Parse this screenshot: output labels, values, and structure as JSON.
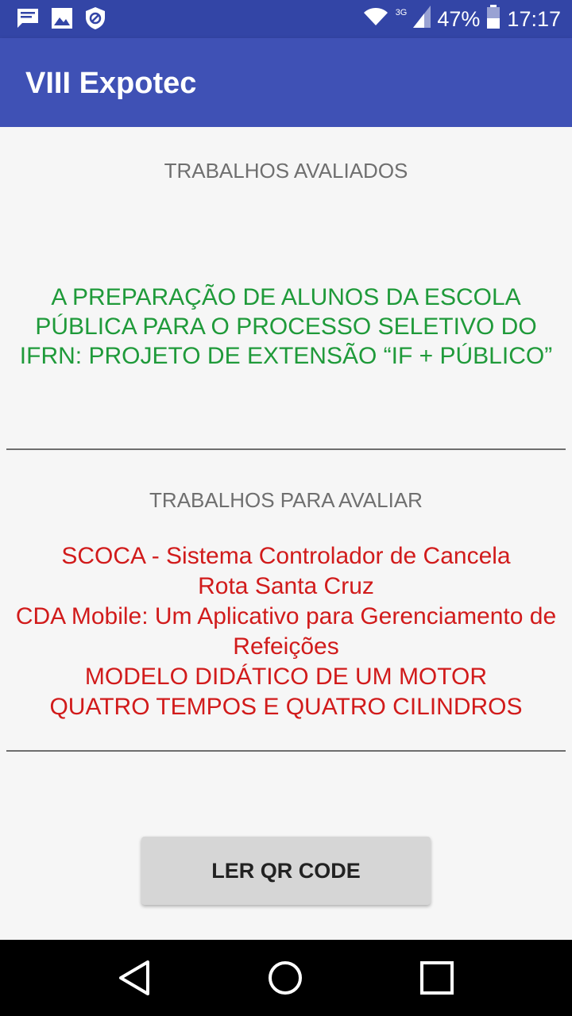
{
  "status_bar": {
    "network": "3G",
    "battery": "47%",
    "time": "17:17",
    "icons": [
      "message-icon",
      "image-icon",
      "shield-icon",
      "wifi-icon",
      "signal-icon",
      "battery-icon"
    ]
  },
  "app_bar": {
    "title": "VIII Expotec"
  },
  "evaluated_section": {
    "title": "TRABALHOS AVALIADOS",
    "items": [
      "A PREPARAÇÃO DE ALUNOS DA ESCOLA PÚBLICA PARA O PROCESSO SELETIVO DO IFRN: PROJETO DE EXTENSÃO “IF + PÚBLICO”"
    ],
    "color": "#1f9a3a"
  },
  "pending_section": {
    "title": "TRABALHOS PARA AVALIAR",
    "items": [
      "SCOCA - Sistema Controlador de Cancela",
      "Rota Santa Cruz",
      "CDA Mobile: Um Aplicativo para Gerenciamento de Refeições",
      "MODELO DIDÁTICO DE UM MOTOR QUATRO TEMPOS E QUATRO CILINDROS"
    ],
    "color": "#d11b1b"
  },
  "action_button": {
    "label": "LER QR CODE"
  },
  "nav_bar": {
    "icons": [
      "back-icon",
      "home-icon",
      "recents-icon"
    ]
  },
  "colors": {
    "primary": "#3f51b5",
    "primary_dark": "#3345a6"
  }
}
